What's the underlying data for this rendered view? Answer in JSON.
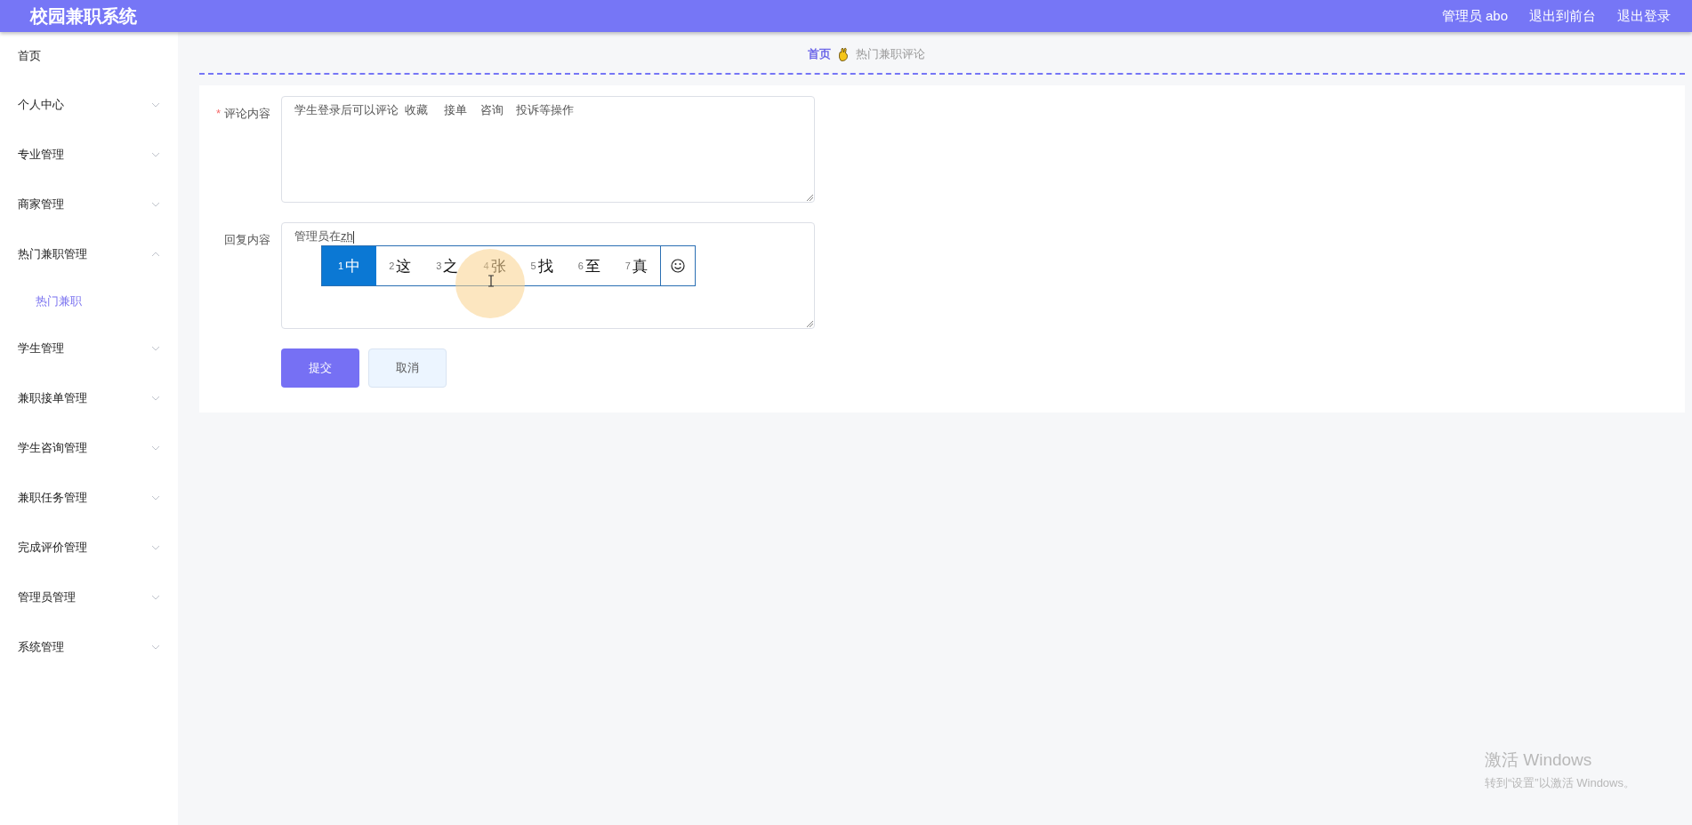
{
  "header": {
    "title": "校园兼职系统",
    "links": [
      "管理员 abo",
      "退出到前台",
      "退出登录"
    ]
  },
  "sidebar": {
    "items": [
      {
        "label": "首页",
        "kind": "link"
      },
      {
        "label": "个人中心",
        "kind": "menu",
        "expanded": false
      },
      {
        "label": "专业管理",
        "kind": "menu",
        "expanded": false
      },
      {
        "label": "商家管理",
        "kind": "menu",
        "expanded": false
      },
      {
        "label": "热门兼职管理",
        "kind": "menu",
        "expanded": true,
        "children": [
          {
            "label": "热门兼职",
            "selected": true
          }
        ]
      },
      {
        "label": "学生管理",
        "kind": "menu",
        "expanded": false
      },
      {
        "label": "兼职接单管理",
        "kind": "menu",
        "expanded": false
      },
      {
        "label": "学生咨询管理",
        "kind": "menu",
        "expanded": false
      },
      {
        "label": "兼职任务管理",
        "kind": "menu",
        "expanded": false
      },
      {
        "label": "完成评价管理",
        "kind": "menu",
        "expanded": false
      },
      {
        "label": "管理员管理",
        "kind": "menu",
        "expanded": false
      },
      {
        "label": "系统管理",
        "kind": "menu",
        "expanded": false
      }
    ]
  },
  "breadcrumb": [
    "首页",
    "热门兼职评论"
  ],
  "form": {
    "fields": [
      {
        "label": "评论内容",
        "required_mark": "*",
        "value": "学生登录后可以评论  收藏     接单    咨询    投诉等操作"
      },
      {
        "label": "回复内容",
        "value": "管理员在",
        "composition": "zh"
      }
    ],
    "buttons": [
      {
        "label": "提交",
        "kind": "primary"
      },
      {
        "label": "取消",
        "kind": "secondary"
      }
    ]
  },
  "ime": {
    "candidates": [
      {
        "index": "1",
        "text": "中",
        "selected": true
      },
      {
        "index": "2",
        "text": "这",
        "selected": false
      },
      {
        "index": "3",
        "text": "之",
        "selected": false
      },
      {
        "index": "4",
        "text": "张",
        "selected": false
      },
      {
        "index": "5",
        "text": "找",
        "selected": false
      },
      {
        "index": "6",
        "text": "至",
        "selected": false
      },
      {
        "index": "7",
        "text": "真",
        "selected": false
      }
    ]
  },
  "activation_notice": {
    "title": "激活 Windows",
    "subtitle": "转到“设置”以激活 Windows。"
  }
}
